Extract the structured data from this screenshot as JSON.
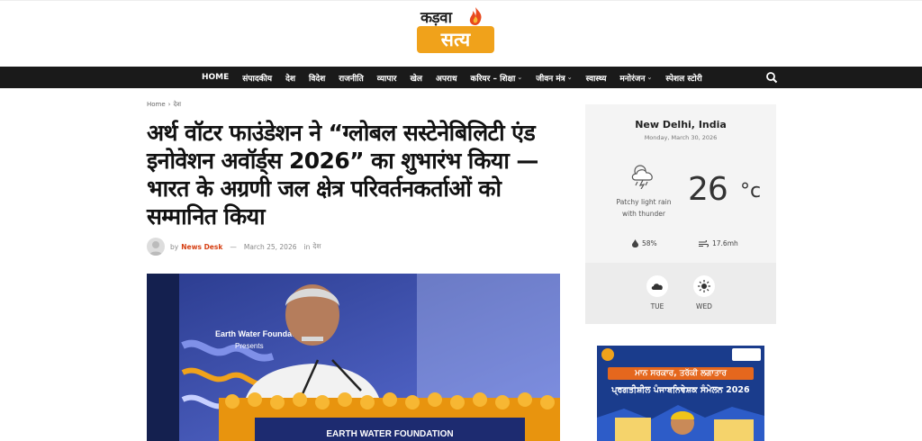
{
  "brand": {
    "top": "कड़वा",
    "box": "सत्य",
    "accent": "#f0a21b"
  },
  "nav": {
    "items": [
      {
        "label": "HOME"
      },
      {
        "label": "संपादकीय"
      },
      {
        "label": "देश"
      },
      {
        "label": "विदेश"
      },
      {
        "label": "राजनीति"
      },
      {
        "label": "व्यापार"
      },
      {
        "label": "खेल"
      },
      {
        "label": "अपराध"
      },
      {
        "label": "करियर – शिक्षा",
        "caret": "⌄"
      },
      {
        "label": "जीवन मंत्र",
        "caret": "⌄"
      },
      {
        "label": "स्वास्थ्य"
      },
      {
        "label": "मनोरंजन",
        "caret": "⌄"
      },
      {
        "label": "स्पेशल स्टोरी"
      }
    ],
    "search_icon": "search-icon"
  },
  "breadcrumb": {
    "home": "Home",
    "sep": "›",
    "section": "देश"
  },
  "article": {
    "title": "अर्थ वॉटर फाउंडेशन ने “ग्लोबल सस्टेनेबिलिटी एंड इनोवेशन अवॉर्ड्स 2026” का शुभारंभ किया — भारत के अग्रणी जल क्षेत्र परिवर्तनकर्ताओं को सम्मानित किया",
    "by": "by",
    "author": "News Desk",
    "dash": "—",
    "date": "March 25, 2026",
    "in": "in",
    "category": "देश",
    "image": {
      "banner_title": "Earth Water Foundation",
      "banner_presents": "Presents",
      "podium_text": "EARTH WATER FOUNDATION"
    }
  },
  "weather": {
    "city": "New Delhi, India",
    "date": "Monday, March 30, 2026",
    "condition_line1": "Patchy light rain",
    "condition_line2": "with thunder",
    "temp": "26",
    "unit": "°c",
    "humidity": "58%",
    "wind": "17.6mh",
    "forecast": [
      {
        "day": "TUE",
        "icon": "cloud-icon"
      },
      {
        "day": "WED",
        "icon": "sun-icon"
      }
    ]
  },
  "ad": {
    "band": "ਮਾਨ ਸਰਕਾਰ, ਤਰੱਕੀ ਲਗਾਤਾਰ",
    "title": "ਪ੍ਰਗਤੀਸ਼ੀਲ ਪੰਜਾਬਨਿਵੇਸ਼ਕ ਸੰਮੇਲਨ 2026"
  }
}
